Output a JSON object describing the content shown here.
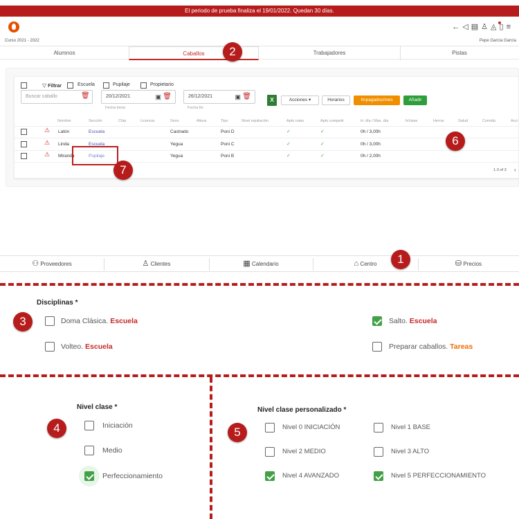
{
  "trial_banner": "El periodo de prueba finaliza el 19/01/2022. Quedan 30 días.",
  "header": {
    "course": "Curso 2021 - 2022",
    "user": "Pepe García García",
    "icons": [
      "back-arrow-icon",
      "megaphone-icon",
      "cash-register-icon",
      "shirt-icon",
      "bell-icon",
      "phone-icon",
      "menu-icon"
    ]
  },
  "tabs": [
    "Alumnos",
    "Caballos",
    "Trabajadores",
    "Pistas"
  ],
  "active_tab": "Caballos",
  "filter": {
    "label": "Filtrar",
    "options": [
      "Escuela",
      "Pupilaje",
      "Propietario"
    ],
    "search_placeholder": "Buscar caballo",
    "date_start": "20/12/2021",
    "date_start_label": "Fecha inicio",
    "date_end": "26/12/2021",
    "date_end_label": "Fecha fin"
  },
  "toolbar": {
    "actions": "Acciones",
    "hours": "Horarios",
    "unpaid": "Impagados/mes",
    "add": "Añadir"
  },
  "table": {
    "headers": [
      "Nombre",
      "Sección",
      "Chip",
      "Licencia",
      "Sexo",
      "Altura",
      "Tipo",
      "Nivel equitación",
      "Apto rutas",
      "Apto competir",
      "H. día / Max. día",
      "h/clase",
      "Herrar",
      "Salud",
      "Comida",
      "Acci"
    ],
    "rows": [
      {
        "name": "Latón",
        "section": "Escuela",
        "sex": "Castrado",
        "type": "Poni D",
        "routes": "✓",
        "compete": "✓",
        "hours": "0h / 3,00h"
      },
      {
        "name": "Linda",
        "section": "Escuela",
        "sex": "Yegua",
        "type": "Poni C",
        "routes": "✓",
        "compete": "✓",
        "hours": "0h / 3,00h"
      },
      {
        "name": "Miranda",
        "section": "Pupilaje",
        "sex": "Yegua",
        "type": "Poni B",
        "routes": "✓",
        "compete": "✓",
        "hours": "0h / 2,00h"
      }
    ],
    "pagination": "1-3 of 3"
  },
  "bottom_nav": [
    "Proveedores",
    "Clientes",
    "Calendario",
    "Centro",
    "Precios"
  ],
  "badges": [
    "1",
    "2",
    "3",
    "4",
    "5",
    "6",
    "7"
  ],
  "disciplinas": {
    "title": "Disciplinas *",
    "items": [
      {
        "label": "Doma Clásica.",
        "tag": "Escuela",
        "checked": false
      },
      {
        "label": "Salto.",
        "tag": "Escuela",
        "checked": true
      },
      {
        "label": "Volteo.",
        "tag": "Escuela",
        "checked": false
      },
      {
        "label": "Preparar caballos.",
        "tag": "Tareas",
        "checked": false
      }
    ]
  },
  "nivel_clase": {
    "title": "Nivel clase *",
    "items": [
      {
        "label": "Iniciación",
        "checked": false
      },
      {
        "label": "Medio",
        "checked": false
      },
      {
        "label": "Perfeccionamiento",
        "checked": true
      }
    ]
  },
  "nivel_personalizado": {
    "title": "Nivel clase personalizado *",
    "items": [
      {
        "label": "Nivel 0 INICIACIÓN",
        "checked": false
      },
      {
        "label": "Nivel 1 BASE",
        "checked": false
      },
      {
        "label": "Nivel 2 MEDIO",
        "checked": false
      },
      {
        "label": "Nivel 3 ALTO",
        "checked": false
      },
      {
        "label": "Nivel 4 AVANZADO",
        "checked": true
      },
      {
        "label": "Nivel 5 PERFECCIONAMIENTO",
        "checked": true
      }
    ]
  },
  "colors": {
    "brand_red": "#b71c1c",
    "green": "#43a047",
    "orange": "#ef6c00",
    "link_blue": "#3f51b5"
  }
}
